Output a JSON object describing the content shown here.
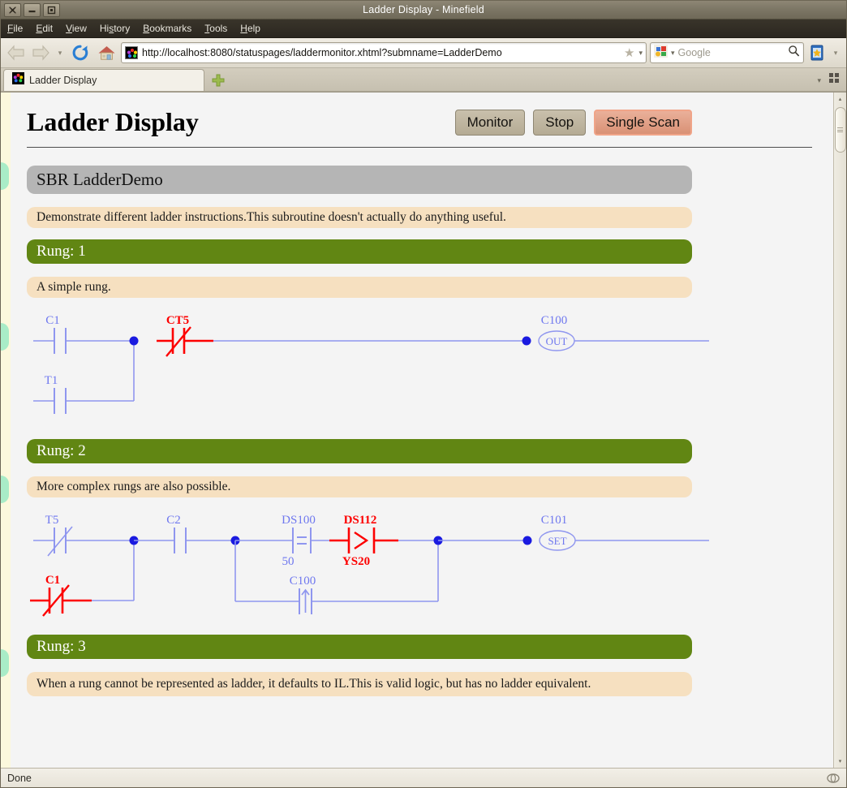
{
  "window": {
    "title": "Ladder Display - Minefield",
    "buttons": {
      "close": "✕",
      "minimize": "—",
      "maximize": "□"
    }
  },
  "menu": {
    "items": [
      {
        "label": "File"
      },
      {
        "label": "Edit"
      },
      {
        "label": "View"
      },
      {
        "label": "History"
      },
      {
        "label": "Bookmarks"
      },
      {
        "label": "Tools"
      },
      {
        "label": "Help"
      }
    ]
  },
  "toolbar": {
    "back_icon": "back-arrow-icon",
    "forward_icon": "forward-arrow-icon",
    "history_caret": "▾",
    "reload_icon": "reload-icon",
    "home_icon": "home-icon",
    "url": "http://localhost:8080/statuspages/laddermonitor.xhtml?submname=LadderDemo",
    "star_icon": "★",
    "url_caret": "▾",
    "search_placeholder": "Google",
    "search_engine_caret": "▾",
    "search_icon": "magnifier-icon",
    "bookmarks_icon": "bookmarks-book-icon",
    "bookmarks_caret": "▾"
  },
  "tabs": {
    "items": [
      {
        "label": "Ladder Display"
      }
    ],
    "new_tab_icon": "plus-icon",
    "list_caret": "▾",
    "grid_icon": "app-grid-icon"
  },
  "page": {
    "title": "Ladder Display",
    "buttons": [
      {
        "label": "Monitor",
        "state": "normal"
      },
      {
        "label": "Stop",
        "state": "normal"
      },
      {
        "label": "Single Scan",
        "state": "highlighted"
      }
    ],
    "subroutine_header": "SBR LadderDemo",
    "subroutine_desc": "Demonstrate different ladder instructions.This subroutine doesn't actually do anything useful.",
    "rungs": [
      {
        "header": "Rung: 1",
        "comment": "A simple rung.",
        "has_ladder": true,
        "elements": {
          "branch_top": "C1",
          "branch_bottom": "T1",
          "series": "CT5",
          "series_state": "active",
          "coil_label": "C100",
          "coil_type": "OUT"
        }
      },
      {
        "header": "Rung: 2",
        "comment": "More complex rungs are also possible.",
        "has_ladder": true,
        "elements": {
          "branch1_top": "T5",
          "branch1_bottom": "C1",
          "branch1_bottom_state": "active",
          "series1": "C2",
          "branch2_top": "DS100",
          "branch2_top_value": "50",
          "branch2_top_op": "=",
          "compare_top": "DS112",
          "compare_bottom": "YS20",
          "compare_op": ">",
          "compare_state": "active",
          "branch2_bottom": "C100",
          "branch2_bottom_op": "rising-edge",
          "coil_label": "C101",
          "coil_type": "SET"
        }
      },
      {
        "header": "Rung: 3",
        "comment": "When a rung cannot be represented as ladder, it defaults to IL.This is valid logic, but has no ladder equivalent.",
        "has_ladder": false
      }
    ],
    "colors": {
      "wire": "#8f96ef",
      "active": "#fd0000",
      "junction": "#1a1ae0",
      "rung_header_bg": "#618613",
      "comment_bg": "#f6e0c0",
      "sbr_bg": "#b5b5b5",
      "accent_highlight": "#e09a7d"
    }
  },
  "statusbar": {
    "text": "Done",
    "right_icon": "progress-icon"
  },
  "scrollbar": {
    "up_arrow": "▴",
    "down_arrow": "▾"
  }
}
